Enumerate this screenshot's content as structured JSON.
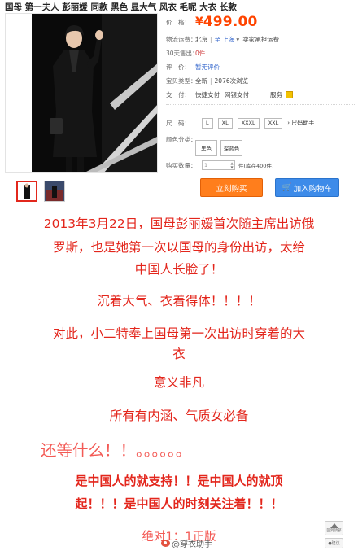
{
  "product": {
    "title": "国母 第一夫人 彭丽媛 同款 黑色 显大气 风衣 毛呢 大衣 长款"
  },
  "info": {
    "price_label": "价　格：",
    "price_currency": "¥",
    "price_value": "499.00",
    "shipping_label": "物流运费：",
    "shipping_from": "北京",
    "shipping_to": "至 上海",
    "shipping_dropdown": "▾",
    "shipping_note": "卖家承担运费",
    "sold_label": "30天售出：",
    "sold_value": "0件",
    "rating_label": "评　价：",
    "rating_value": "暂无评价",
    "detail_label": "宝贝类型：",
    "detail_value": "全新",
    "detail_views": "2076次浏览",
    "payment_label": "支　付：",
    "payment_1": "快捷支付",
    "payment_2": "网银支付",
    "guarantee_label": "服务",
    "size_label": "尺　码：",
    "sizes": [
      "L",
      "XL",
      "XXXL",
      "XXL"
    ],
    "size_guide": "› 尺码助手",
    "color_label": "颜色分类：",
    "colors": [
      "黑色",
      "深蓝色"
    ],
    "qty_label": "购买数量：",
    "qty_value": "1",
    "qty_stock": "件(库存400件)"
  },
  "buttons": {
    "buy_now": "立刻购买",
    "add_cart": "加入购物车"
  },
  "description": {
    "line1": "2013年3月22日，国母彭丽媛首次随主席出访俄",
    "line2": "罗斯，也是她第一次以国母的身份出访，太给",
    "line3": "中国人长脸了！",
    "line4": "沉着大气、衣着得体！！！！",
    "line5": "对此，小二特奉上国母第一次出访时穿着的大",
    "line6": "衣",
    "line7": "意义非凡",
    "line8": "所有有内涵、气质女必备",
    "line9": "还等什么！！。。。。。。",
    "line10": "是中国人的就支持！！是中国人的就顶",
    "line11": "起！！！是中国人的时刻关注着！！！",
    "line12": "绝对1：1正版"
  },
  "sidebar": {
    "back_to_top": "回到顶部",
    "feedback": "●建议"
  },
  "watermark": {
    "text": "@穿衣助手"
  },
  "colors": {
    "price": "#ff4400",
    "desc_red": "#e3261c",
    "buy_button": "#ff7e1c",
    "cart_button": "#3d8be9"
  }
}
